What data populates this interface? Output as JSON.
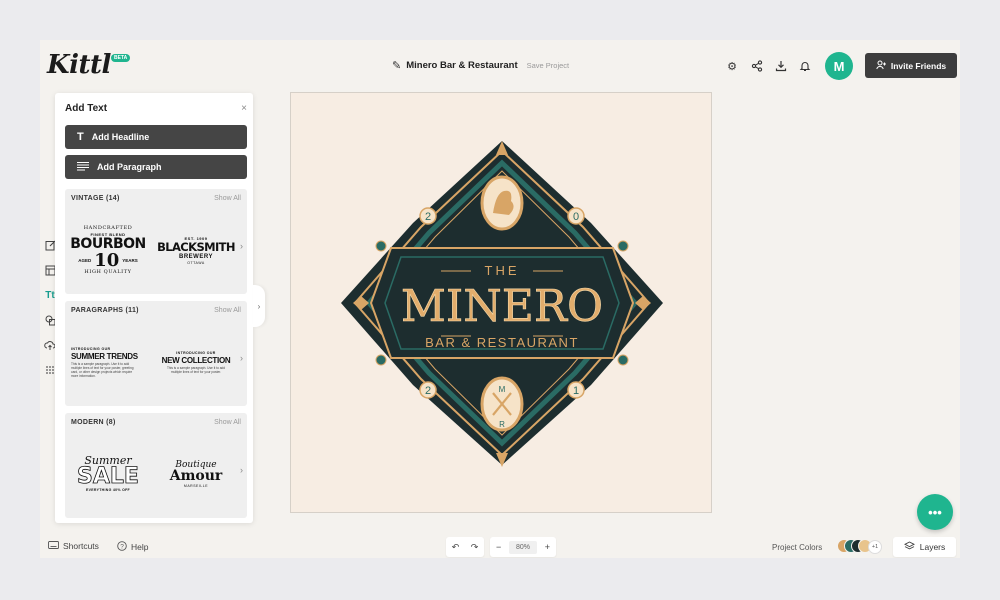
{
  "brand": {
    "logo": "Kittl",
    "badge": "BETA"
  },
  "header": {
    "project_title": "Minero Bar & Restaurant",
    "save_label": "Save Project",
    "avatar_initial": "M",
    "invite_label": "Invite Friends",
    "icons": [
      "gear-icon",
      "share-icon",
      "download-icon",
      "bell-icon"
    ]
  },
  "panel": {
    "title": "Add Text",
    "close": "×",
    "headline_button": "Add Headline",
    "paragraph_button": "Add Paragraph",
    "sections": [
      {
        "title": "VINTAGE (14)",
        "show_all": "Show All",
        "samples": [
          {
            "top": "HANDCRAFTED",
            "line2": "FINEST BLEND",
            "main": "BOURBON",
            "left": "AGED",
            "number": "10",
            "right": "YEARS",
            "bottom": "HIGH QUALITY"
          },
          {
            "top": "EST. 1909",
            "main": "BLACKSMITH",
            "line2": "BREWERY",
            "bottom": "OTTAWA"
          }
        ]
      },
      {
        "title": "PARAGRAPHS (11)",
        "show_all": "Show All",
        "samples": [
          {
            "kicker": "INTRODUCING OUR",
            "main": "SUMMER TRENDS",
            "body": "This is a sample paragraph. Use it to add multiple lines of text for your poster, greeting card, or other design projects which require more information."
          },
          {
            "kicker": "INTRODUCING OUR",
            "main": "NEW COLLECTION",
            "body": "This is a sample paragraph. Use it to add multiple lines of text for your poster."
          }
        ]
      },
      {
        "title": "MODERN (8)",
        "show_all": "Show All",
        "samples": [
          {
            "script": "Summer",
            "main": "SALE",
            "bottom": "EVERYTHING 40% OFF"
          },
          {
            "script": "Boutique",
            "main": "Amour",
            "bottom": "MARSEILLE"
          }
        ]
      }
    ]
  },
  "canvas": {
    "logo_the": "THE",
    "logo_name": "MINERO",
    "logo_sub": "BAR & RESTAURANT",
    "digits": [
      "2",
      "0",
      "2",
      "1"
    ],
    "monogram": [
      "M",
      "R"
    ],
    "colors": {
      "bg": "#f7ede3",
      "dark": "#1d2d2f",
      "teal": "#2a6b64",
      "gold": "#d8a566",
      "cream": "#f6e3c8"
    }
  },
  "bottom": {
    "shortcuts": "Shortcuts",
    "help": "Help",
    "zoom": "80%",
    "project_colors_label": "Project Colors",
    "swatches": [
      "#d8a566",
      "#2a6b64",
      "#1d2d2f",
      "#e8c48c"
    ],
    "more_colors": "+1",
    "layers_label": "Layers"
  }
}
